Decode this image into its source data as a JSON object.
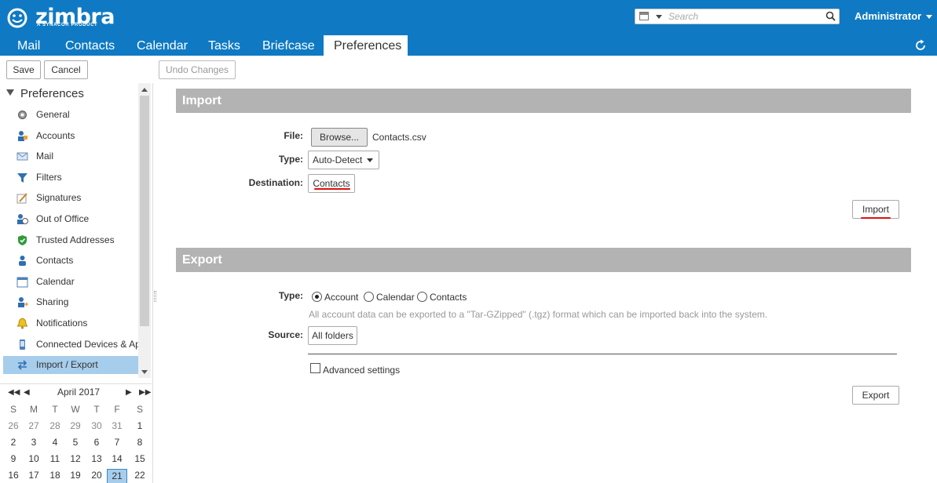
{
  "header": {
    "logo_word": "zimbra",
    "logo_tag": "A SYNACOR PRODUCT",
    "search_placeholder": "Search",
    "user": "Administrator"
  },
  "tabs": [
    "Mail",
    "Contacts",
    "Calendar",
    "Tasks",
    "Briefcase",
    "Preferences"
  ],
  "active_tab": "Preferences",
  "toolbar": {
    "save": "Save",
    "cancel": "Cancel",
    "undo": "Undo Changes"
  },
  "sidebar": {
    "title": "Preferences",
    "items": [
      {
        "label": "General",
        "icon": "gear-icon"
      },
      {
        "label": "Accounts",
        "icon": "accounts-icon"
      },
      {
        "label": "Mail",
        "icon": "envelope-icon"
      },
      {
        "label": "Filters",
        "icon": "filter-icon"
      },
      {
        "label": "Signatures",
        "icon": "signature-icon"
      },
      {
        "label": "Out of Office",
        "icon": "out-of-office-icon"
      },
      {
        "label": "Trusted Addresses",
        "icon": "shield-check-icon"
      },
      {
        "label": "Contacts",
        "icon": "contact-person-icon"
      },
      {
        "label": "Calendar",
        "icon": "calendar-icon"
      },
      {
        "label": "Sharing",
        "icon": "sharing-icon"
      },
      {
        "label": "Notifications",
        "icon": "bell-icon"
      },
      {
        "label": "Connected Devices & Ap",
        "icon": "mobile-device-icon"
      },
      {
        "label": "Import / Export",
        "icon": "import-export-icon"
      }
    ],
    "selected": "Import / Export"
  },
  "mini_calendar": {
    "month": "April 2017",
    "dow": [
      "S",
      "M",
      "T",
      "W",
      "T",
      "F",
      "S"
    ],
    "weeks": [
      [
        "26",
        "27",
        "28",
        "29",
        "30",
        "31",
        "1"
      ],
      [
        "2",
        "3",
        "4",
        "5",
        "6",
        "7",
        "8"
      ],
      [
        "9",
        "10",
        "11",
        "12",
        "13",
        "14",
        "15"
      ],
      [
        "16",
        "17",
        "18",
        "19",
        "20",
        "21",
        "22"
      ]
    ],
    "today": "21"
  },
  "import": {
    "title": "Import",
    "file_label": "File:",
    "browse": "Browse...",
    "file_name": "Contacts.csv",
    "type_label": "Type:",
    "type_value": "Auto-Detect",
    "destination_label": "Destination:",
    "destination_value": "Contacts",
    "button": "Import"
  },
  "export": {
    "title": "Export",
    "type_label": "Type:",
    "options": [
      "Account",
      "Calendar",
      "Contacts"
    ],
    "selected": "Account",
    "hint": "All account data can be exported to a \"Tar-GZipped\" (.tgz) format which can be imported back into the system.",
    "source_label": "Source:",
    "source_value": "All folders",
    "advanced": "Advanced settings",
    "button": "Export"
  },
  "colors": {
    "brand_blue": "#0f7ac3",
    "selected_bg": "#a6cdeb",
    "section_bar": "#b3b3b3",
    "annotation_red": "#dd1111"
  }
}
